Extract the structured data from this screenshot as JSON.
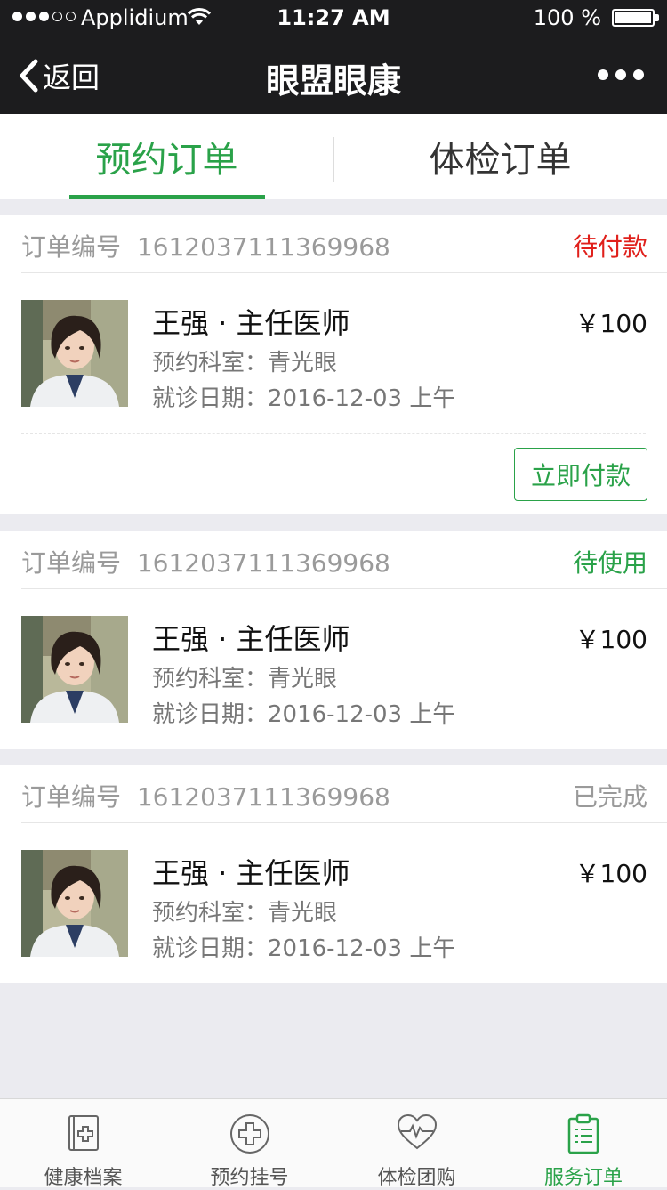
{
  "status_bar": {
    "carrier": "Applidium",
    "time": "11:27 AM",
    "battery": "100 %"
  },
  "nav": {
    "back_label": "返回",
    "title": "眼盟眼康"
  },
  "tabs": [
    {
      "label": "预约订单",
      "active": true
    },
    {
      "label": "体检订单",
      "active": false
    }
  ],
  "orders": [
    {
      "order_label": "订单编号",
      "order_no": "1612037111369968",
      "status": "待付款",
      "status_color": "#e0201b",
      "doctor": "王强 · 主任医师",
      "price": "￥100",
      "dept": "预约科室：青光眼",
      "date": "就诊日期：2016-12-03  上午",
      "action": "立即付款"
    },
    {
      "order_label": "订单编号",
      "order_no": "1612037111369968",
      "status": "待使用",
      "status_color": "#2aa249",
      "doctor": "王强 · 主任医师",
      "price": "￥100",
      "dept": "预约科室：青光眼",
      "date": "就诊日期：2016-12-03  上午"
    },
    {
      "order_label": "订单编号",
      "order_no": "1612037111369968",
      "status": "已完成",
      "status_color": "#9a9a9a",
      "doctor": "王强 · 主任医师",
      "price": "￥100",
      "dept": "预约科室：青光眼",
      "date": "就诊日期：2016-12-03  上午"
    }
  ],
  "bottom_tabs": [
    {
      "label": "健康档案",
      "icon": "health-record-icon",
      "active": false
    },
    {
      "label": "预约挂号",
      "icon": "medical-cross-icon",
      "active": false
    },
    {
      "label": "体检团购",
      "icon": "heart-pulse-icon",
      "active": false
    },
    {
      "label": "服务订单",
      "icon": "clipboard-icon",
      "active": true
    }
  ],
  "colors": {
    "accent": "#2aa249",
    "unpaid": "#e0201b",
    "navbar": "#1c1c1e"
  }
}
